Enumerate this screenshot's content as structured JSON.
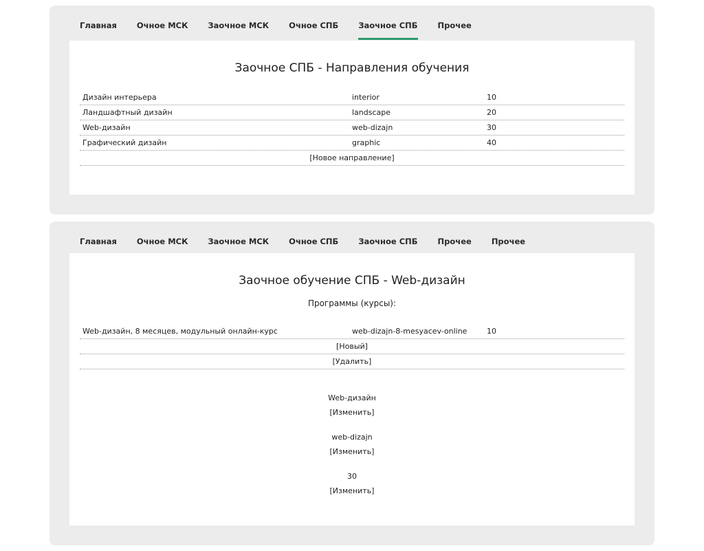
{
  "panel1": {
    "nav": [
      "Главная",
      "Очное МСК",
      "Заочное МСК",
      "Очное СПБ",
      "Заочное СПБ",
      "Прочее"
    ],
    "title": "Заочное СПБ - Направления обучения",
    "rows": [
      {
        "name": "Дизайн интерьера",
        "slug": "interior",
        "order": "10"
      },
      {
        "name": "Ландшафтный дизайн",
        "slug": "landscape",
        "order": "20"
      },
      {
        "name": "Web-дизайн",
        "slug": "web-dizajn",
        "order": "30"
      },
      {
        "name": "Графический дизайн",
        "slug": "graphic",
        "order": "40"
      }
    ],
    "new_link": "[Новое направление]"
  },
  "panel2": {
    "nav": [
      "Главная",
      "Очное МСК",
      "Заочное МСК",
      "Очное СПБ",
      "Заочное СПБ",
      "Прочее",
      "Прочее"
    ],
    "title": "Заочное обучение СПБ - Web-дизайн",
    "subtitle": "Программы (курсы):",
    "rows": [
      {
        "name": "Web-дизайн, 8 месяцев, модульный онлайн-курс",
        "slug": "web-dizajn-8-mesyacev-online",
        "order": "10"
      }
    ],
    "new_link": "[Новый]",
    "delete_link": "[Удалить]",
    "fields": [
      {
        "value": "Web-дизайн",
        "edit": "[Изменить]"
      },
      {
        "value": "web-dizajn",
        "edit": "[Изменить]"
      },
      {
        "value": "30",
        "edit": "[Изменить]"
      }
    ]
  },
  "colors": {
    "accent": "#2b9a6d",
    "panel_bg": "#ececec",
    "content_bg": "#ffffff"
  }
}
